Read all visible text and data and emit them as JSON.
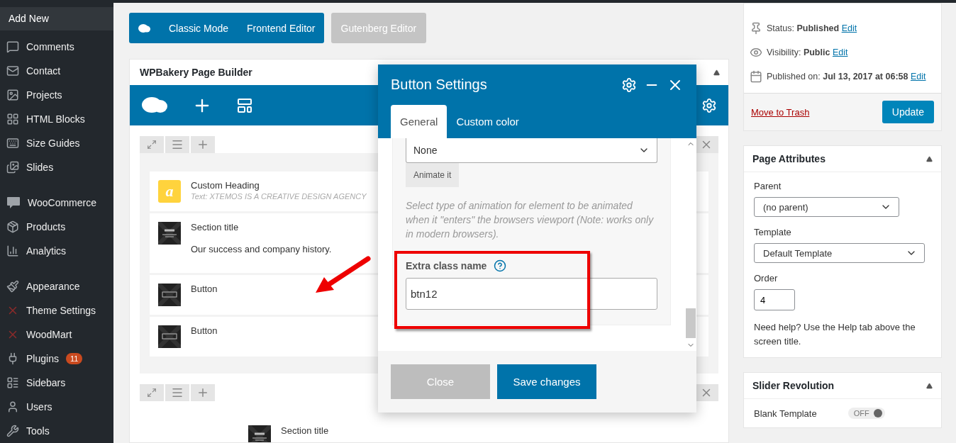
{
  "sidebar": {
    "submenu_item": {
      "label": "Add New",
      "selected": true
    },
    "groups": [
      [
        {
          "label": "Comments"
        },
        {
          "label": "Contact"
        },
        {
          "label": "Projects"
        },
        {
          "label": "HTML Blocks"
        },
        {
          "label": "Size Guides"
        },
        {
          "label": "Slides"
        }
      ],
      [
        {
          "label": "WooCommerce"
        },
        {
          "label": "Products"
        },
        {
          "label": "Analytics"
        }
      ],
      [
        {
          "label": "Appearance"
        },
        {
          "label": "Theme Settings"
        },
        {
          "label": "WoodMart"
        },
        {
          "label": "Plugins",
          "badge": "11"
        },
        {
          "label": "Sidebars"
        },
        {
          "label": "Users"
        },
        {
          "label": "Tools"
        }
      ]
    ]
  },
  "editor_modes": [
    {
      "label": "Classic Mode",
      "disabled": false
    },
    {
      "label": "Frontend Editor",
      "disabled": false
    },
    {
      "label": "Gutenberg Editor",
      "disabled": true
    }
  ],
  "builder": {
    "title": "WPBakery Page Builder",
    "rows": [
      {
        "elements": [
          {
            "kind": "heading",
            "icon_letter": "a",
            "title": "Custom Heading",
            "subtitle": "Text: XTEMOS IS A CREATIVE DESIGN AGENCY"
          },
          {
            "kind": "title",
            "title": "Section title",
            "text": "Our success and company history."
          },
          {
            "kind": "button",
            "title": "Button"
          },
          {
            "kind": "button",
            "title": "Button"
          }
        ]
      },
      {
        "elements": [
          {
            "kind": "title",
            "title": "Section title"
          }
        ]
      }
    ]
  },
  "modal": {
    "title": "Button Settings",
    "tabs": [
      {
        "label": "General",
        "selected": true
      },
      {
        "label": "Custom color",
        "selected": false
      }
    ],
    "animation_select": "None",
    "animate_button": "Animate it",
    "help": "Select type of animation for element to be animated when it \"enters\" the browsers viewport (Note: works only in modern browsers).",
    "field_label": "Extra class name",
    "field_value": "btn12",
    "buttons": [
      {
        "label": "Close",
        "kind": "secondary"
      },
      {
        "label": "Save changes",
        "kind": "primary"
      }
    ]
  },
  "publish": {
    "lines": [
      {
        "label": "Status:",
        "value": "Published",
        "link": "Edit"
      },
      {
        "label": "Visibility:",
        "value": "Public",
        "link": "Edit"
      },
      {
        "label": "Published on:",
        "value": "Jul 13, 2017 at 06:58",
        "link": "Edit"
      }
    ],
    "trash": "Move to Trash",
    "update": "Update"
  },
  "page_attributes": {
    "title": "Page Attributes",
    "parent_label": "Parent",
    "parent": "(no parent)",
    "template_label": "Template",
    "template": "Default Template",
    "order_label": "Order",
    "order": "4",
    "help": "Need help? Use the Help tab above the screen title."
  },
  "slider_revolution": {
    "title": "Slider Revolution",
    "label": "Blank Template",
    "toggle": "OFF",
    "on": false
  }
}
